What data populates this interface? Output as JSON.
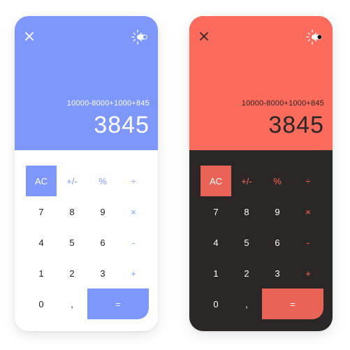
{
  "themes": {
    "light": {
      "accent": "#7e97fb",
      "background": "#ffffff",
      "text": "#222222"
    },
    "dark": {
      "accent": "#fd6b5d",
      "background": "#2b2727",
      "text": "#ffffff"
    }
  },
  "icons": {
    "close": "close-icon",
    "theme": "theme-toggle-icon"
  },
  "calc_light": {
    "expression": "10000-8000+1000+845",
    "result": "3845",
    "keys": {
      "ac": "AC",
      "sign": "+/-",
      "percent": "%",
      "divide": "÷",
      "seven": "7",
      "eight": "8",
      "nine": "9",
      "multiply": "×",
      "four": "4",
      "five": "5",
      "six": "6",
      "minus": "-",
      "one": "1",
      "two": "2",
      "three": "3",
      "plus": "+",
      "zero": "0",
      "decimal": ",",
      "equals": "="
    }
  },
  "calc_dark": {
    "expression": "10000-8000+1000+845",
    "result": "3845",
    "keys": {
      "ac": "AC",
      "sign": "+/-",
      "percent": "%",
      "divide": "÷",
      "seven": "7",
      "eight": "8",
      "nine": "9",
      "multiply": "×",
      "four": "4",
      "five": "5",
      "six": "6",
      "minus": "-",
      "one": "1",
      "two": "2",
      "three": "3",
      "plus": "+",
      "zero": "0",
      "decimal": ",",
      "equals": "="
    }
  }
}
